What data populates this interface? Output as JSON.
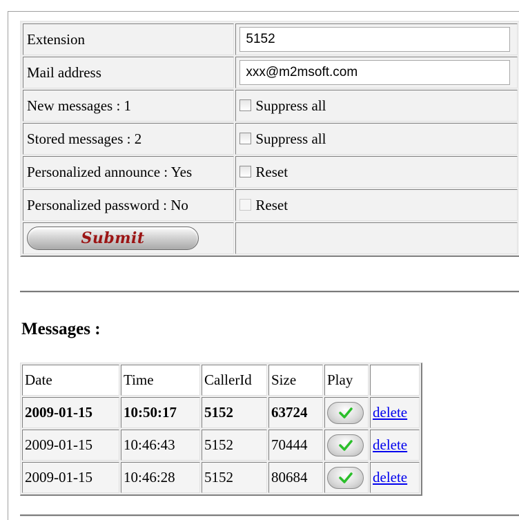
{
  "settings": {
    "rows": [
      {
        "label": "Extension",
        "value": "5152"
      },
      {
        "label": "Mail address",
        "value": "xxx@m2msoft.com"
      },
      {
        "label": "New messages : 1",
        "option": "Suppress all"
      },
      {
        "label": "Stored messages : 2",
        "option": "Suppress all"
      },
      {
        "label": "Personalized announce : Yes",
        "option": "Reset"
      },
      {
        "label": "Personalized password : No",
        "option": "Reset"
      }
    ],
    "submit_label": "Submit"
  },
  "messages": {
    "heading": "Messages :",
    "columns": [
      "Date",
      "Time",
      "CallerId",
      "Size",
      "Play",
      ""
    ],
    "rows": [
      {
        "date": "2009-01-15",
        "time": "10:50:17",
        "caller": "5152",
        "size": "63724",
        "action": "delete"
      },
      {
        "date": "2009-01-15",
        "time": "10:46:43",
        "caller": "5152",
        "size": "70444",
        "action": "delete"
      },
      {
        "date": "2009-01-15",
        "time": "10:46:28",
        "caller": "5152",
        "size": "80684",
        "action": "delete"
      }
    ]
  },
  "colors": {
    "submit_text": "#9b1414",
    "link": "#0000ee",
    "play_check": "#2bbf2b"
  },
  "icons": {
    "play": "play-check-icon"
  }
}
